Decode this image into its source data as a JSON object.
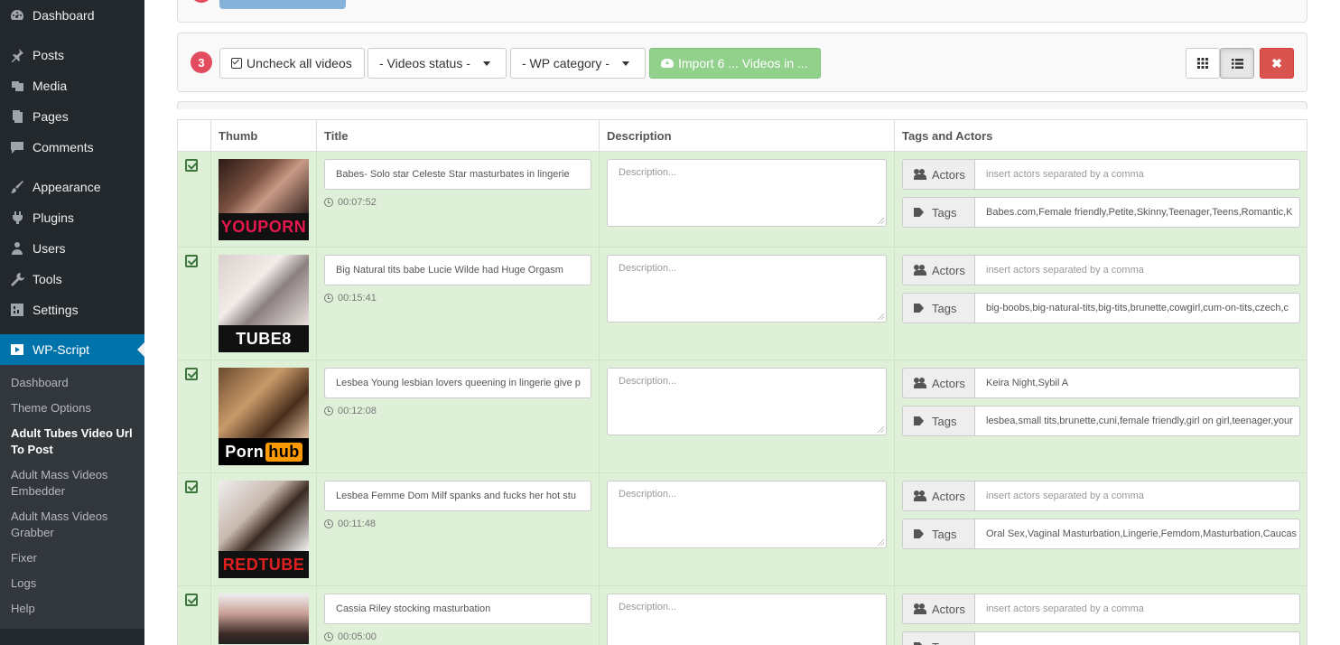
{
  "sidebar": {
    "items": [
      {
        "label": "Dashboard",
        "icon": "dashboard-icon"
      },
      {
        "label": "Posts",
        "icon": "pin-icon"
      },
      {
        "label": "Media",
        "icon": "media-icon"
      },
      {
        "label": "Pages",
        "icon": "pages-icon"
      },
      {
        "label": "Comments",
        "icon": "comments-icon"
      },
      {
        "label": "Appearance",
        "icon": "brush-icon"
      },
      {
        "label": "Plugins",
        "icon": "plugin-icon"
      },
      {
        "label": "Users",
        "icon": "users-icon"
      },
      {
        "label": "Tools",
        "icon": "wrench-icon"
      },
      {
        "label": "Settings",
        "icon": "settings-icon"
      },
      {
        "label": "WP-Script",
        "icon": "play-icon"
      }
    ],
    "submenu": [
      "Dashboard",
      "Theme Options",
      "Adult Tubes Video Url To Post",
      "Adult Mass Videos Embedder",
      "Adult Mass Videos Grabber",
      "Fixer",
      "Logs",
      "Help"
    ]
  },
  "toolbar": {
    "step": "3",
    "uncheck_label": "Uncheck all videos",
    "status_select": "- Videos status -",
    "category_select": "- WP category -",
    "import_label": "Import 6 ... Videos in ..."
  },
  "table": {
    "headers": [
      "Thumb",
      "Title",
      "Description",
      "Tags and Actors"
    ],
    "description_placeholder": "Description...",
    "actors_label": "Actors",
    "tags_label": "Tags",
    "actors_placeholder": "insert actors separated by a comma",
    "rows": [
      {
        "logo": "YOUPORN",
        "title": "Babes- Solo star Celeste Star masturbates in lingerie",
        "duration": "00:07:52",
        "actors": "",
        "tags": "Babes.com,Female friendly,Petite,Skinny,Teenager,Teens,Romantic,K"
      },
      {
        "logo": "TUBE8",
        "title": "Big Natural tits babe Lucie Wilde had Huge Orgasm",
        "duration": "00:15:41",
        "actors": "",
        "tags": "big-boobs,big-natural-tits,big-tits,brunette,cowgirl,cum-on-tits,czech,c"
      },
      {
        "logo": "Pornhub",
        "title": "Lesbea Young lesbian lovers queening in lingerie give p",
        "duration": "00:12:08",
        "actors": "Keira Night,Sybil A",
        "tags": "lesbea,small tits,brunette,cuni,female friendly,girl on girl,teenager,your"
      },
      {
        "logo": "REDTUBE",
        "title": "Lesbea Femme Dom Milf spanks and fucks her hot stu",
        "duration": "00:11:48",
        "actors": "",
        "tags": "Oral Sex,Vaginal Masturbation,Lingerie,Femdom,Masturbation,Caucas"
      },
      {
        "logo": "",
        "title": "Cassia Riley stocking masturbation",
        "duration": "00:05:00",
        "actors": "",
        "tags": ""
      }
    ]
  },
  "colors": {
    "sidebar_bg": "#23282d",
    "active_bg": "#0073aa",
    "row_bg": "#dff0d8",
    "badge": "#e34c5e",
    "import_btn": "#91d18b",
    "close_btn": "#d9534f"
  }
}
